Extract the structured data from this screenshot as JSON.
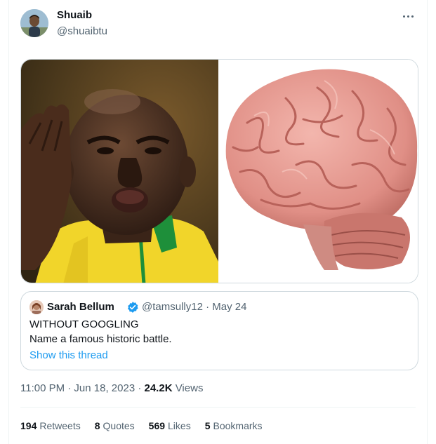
{
  "author": {
    "name": "Shuaib",
    "handle": "@shuaibtu"
  },
  "media": {
    "left_image": "man-in-yellow-shirt-photo",
    "right_image": "human-brain-photo"
  },
  "quote": {
    "name": "Sarah Bellum",
    "handle_date": "@tamsully12 · May 24",
    "line1": "WITHOUT GOOGLING",
    "line2": "Name a famous historic battle.",
    "link": "Show this thread"
  },
  "meta": {
    "time_date": "11:00 PM · Jun 18, 2023 · ",
    "views_count": "24.2K",
    "views_label": " Views"
  },
  "stats": {
    "retweets_count": "194",
    "retweets_label": "Retweets",
    "quotes_count": "8",
    "quotes_label": "Quotes",
    "likes_count": "569",
    "likes_label": "Likes",
    "bookmarks_count": "5",
    "bookmarks_label": "Bookmarks"
  },
  "colors": {
    "accent": "#1d9bf0",
    "muted": "#536471",
    "border": "#cfd9de"
  }
}
